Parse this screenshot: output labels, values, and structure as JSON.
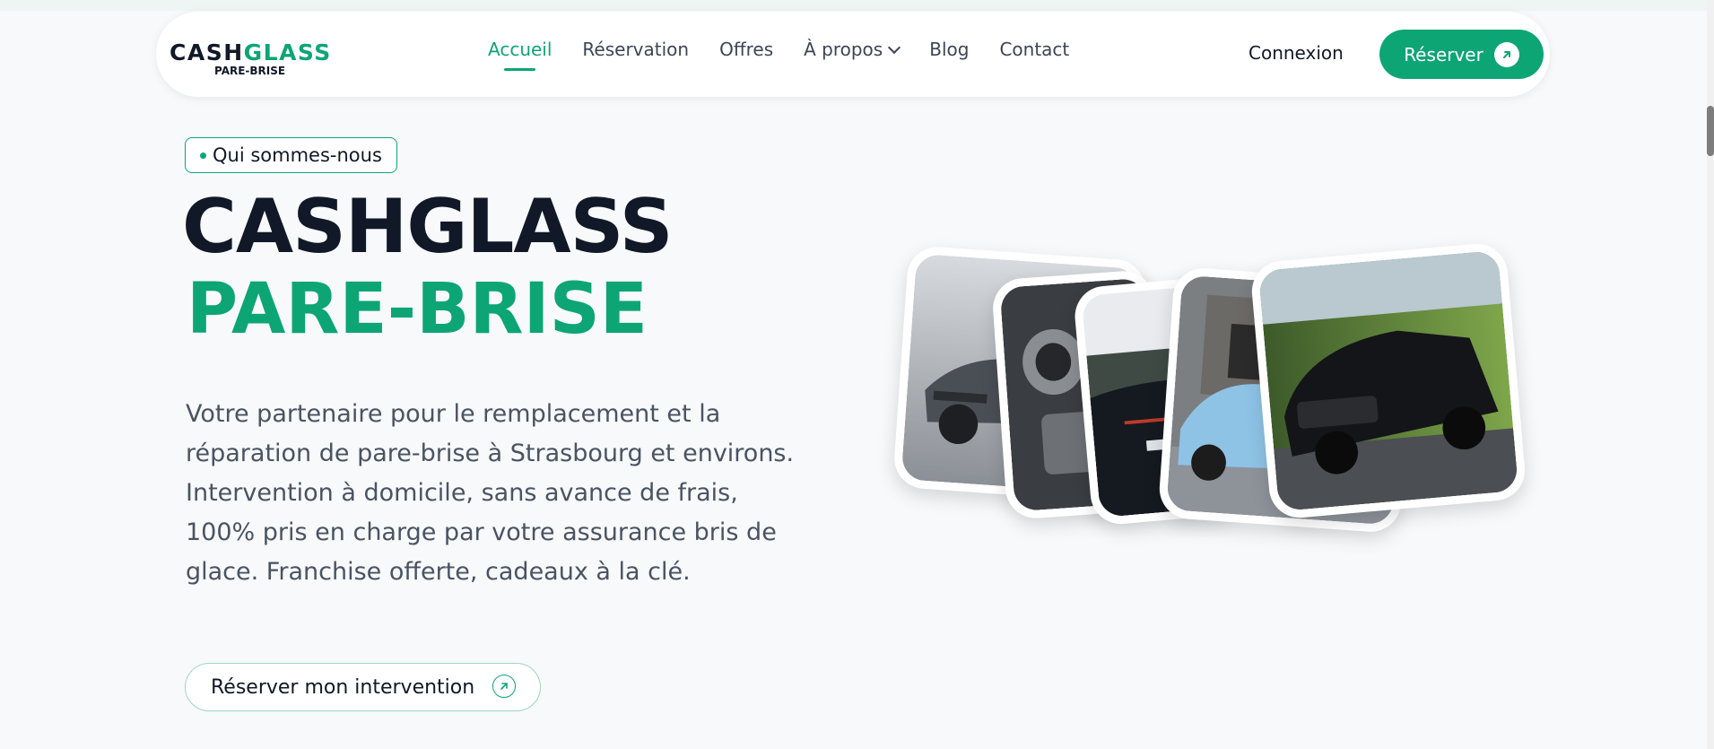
{
  "header": {
    "logo": {
      "line1_a": "CASH",
      "line1_b": "GLASS",
      "line2": "PARE-BRISE"
    },
    "nav": [
      {
        "label": "Accueil",
        "active": true
      },
      {
        "label": "Réservation"
      },
      {
        "label": "Offres"
      },
      {
        "label": "À propos",
        "has_dropdown": true
      },
      {
        "label": "Blog"
      },
      {
        "label": "Contact"
      }
    ],
    "login_label": "Connexion",
    "cta_label": "Réserver"
  },
  "hero": {
    "badge": "Qui sommes-nous",
    "title_line1": "CASHGLASS",
    "title_line2": "PARE-BRISE",
    "description": "Votre partenaire pour le remplacement et la réparation de pare-brise à Strasbourg et environs. Intervention à domicile, sans avance de frais, 100% pris en charge par votre assurance bris de glace. Franchise offerte, cadeaux à la clé.",
    "cta_label": "Réserver mon intervention"
  },
  "gallery": [
    "grey-sports-car-photo",
    "engine-detail-photo",
    "dark-car-rear-photo",
    "blue-small-car-photo",
    "black-sedan-photo"
  ],
  "colors": {
    "accent": "#0da574",
    "text_dark": "#111827",
    "background": "#f7f9fa"
  }
}
